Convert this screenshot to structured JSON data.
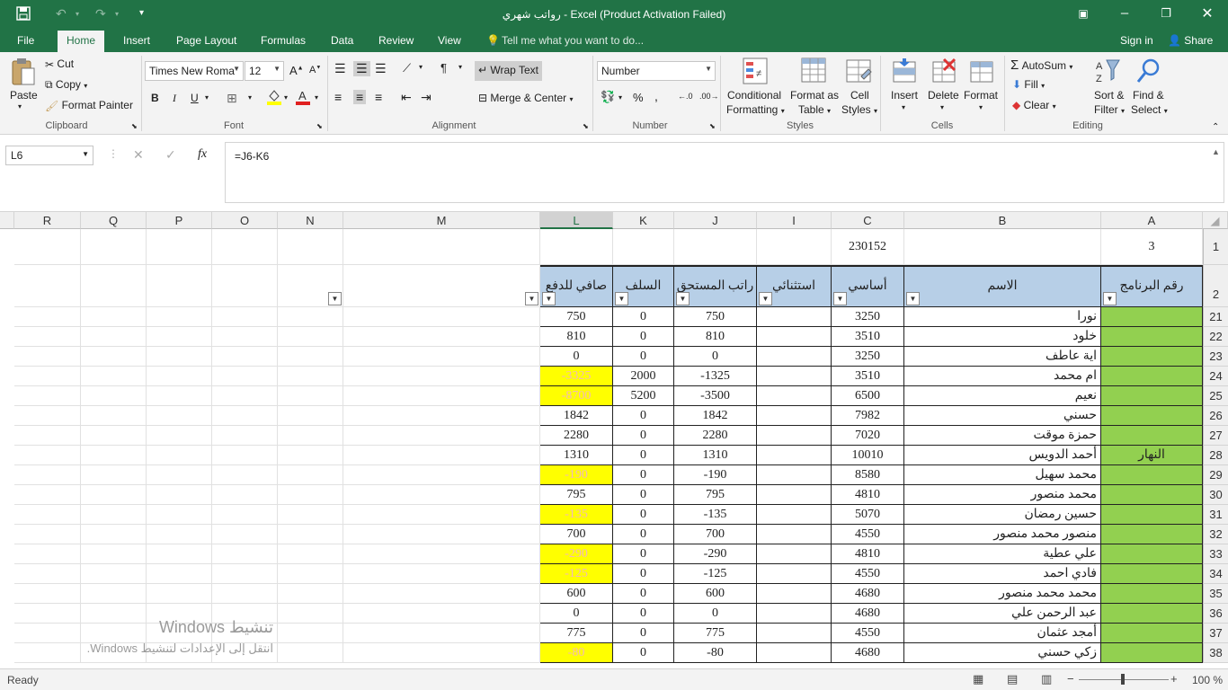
{
  "window": {
    "title": "رواتب شهري - Excel (Product Activation Failed)",
    "accent": "#217346"
  },
  "tabs": [
    "File",
    "Home",
    "Insert",
    "Page Layout",
    "Formulas",
    "Data",
    "Review",
    "View"
  ],
  "tell_me": "Tell me what you want to do...",
  "signin": "Sign in",
  "share": "Share",
  "ribbon": {
    "clipboard": {
      "paste": "Paste",
      "cut": "Cut",
      "copy": "Copy",
      "format_painter": "Format Painter",
      "label": "Clipboard"
    },
    "font": {
      "name": "Times New Roma",
      "size": "12",
      "label": "Font",
      "bold": "B",
      "italic": "I",
      "underline": "U"
    },
    "alignment": {
      "wrap": "Wrap Text",
      "merge": "Merge & Center",
      "label": "Alignment"
    },
    "number": {
      "format": "Number",
      "label": "Number"
    },
    "styles": {
      "conditional": "Conditional",
      "conditional2": "Formatting",
      "format_table": "Format as",
      "format_table2": "Table",
      "cell_styles": "Cell",
      "cell_styles2": "Styles",
      "label": "Styles"
    },
    "cells": {
      "insert": "Insert",
      "delete": "Delete",
      "format": "Format",
      "label": "Cells"
    },
    "editing": {
      "autosum": "AutoSum",
      "fill": "Fill",
      "clear": "Clear",
      "sort": "Sort &",
      "sort2": "Filter",
      "find": "Find &",
      "find2": "Select",
      "label": "Editing"
    }
  },
  "formula_bar": {
    "name_box": "L6",
    "formula": "=J6-K6"
  },
  "columns": [
    "R",
    "Q",
    "P",
    "O",
    "N",
    "M",
    "L",
    "K",
    "J",
    "I",
    "C",
    "B",
    "A"
  ],
  "selected_column": "L",
  "row1": {
    "row": "1",
    "C": "230152",
    "A": "3"
  },
  "headers": {
    "row": "2",
    "L": "صافي للدفع",
    "K": "السلف",
    "J": "راتب المستحق",
    "I": "استثنائي",
    "C": "أساسي",
    "B": "الاسم",
    "A": "رقم البرنامج"
  },
  "rows": [
    {
      "row": "21",
      "B": "نورا",
      "C": "3250",
      "I": "",
      "J": "750",
      "K": "0",
      "L": "750",
      "A": "",
      "yellow": false
    },
    {
      "row": "22",
      "B": "خلود",
      "C": "3510",
      "I": "",
      "J": "810",
      "K": "0",
      "L": "810",
      "A": "",
      "yellow": false
    },
    {
      "row": "23",
      "B": "اية عاطف",
      "C": "3250",
      "I": "",
      "J": "0",
      "K": "0",
      "L": "0",
      "A": "",
      "yellow": false
    },
    {
      "row": "24",
      "B": "ام محمد",
      "C": "3510",
      "I": "",
      "J": "-1325",
      "K": "2000",
      "L": "-3325",
      "A": "",
      "yellow": true
    },
    {
      "row": "25",
      "B": "نعيم",
      "C": "6500",
      "I": "",
      "J": "-3500",
      "K": "5200",
      "L": "-8700",
      "A": "",
      "yellow": true
    },
    {
      "row": "26",
      "B": "حسني",
      "C": "7982",
      "I": "",
      "J": "1842",
      "K": "0",
      "L": "1842",
      "A": "",
      "yellow": false
    },
    {
      "row": "27",
      "B": "حمزة موقت",
      "C": "7020",
      "I": "",
      "J": "2280",
      "K": "0",
      "L": "2280",
      "A": "",
      "yellow": false
    },
    {
      "row": "28",
      "B": "أحمد الدويس",
      "C": "10010",
      "I": "",
      "J": "1310",
      "K": "0",
      "L": "1310",
      "A": "النهار",
      "yellow": false
    },
    {
      "row": "29",
      "B": "محمد سهيل",
      "C": "8580",
      "I": "",
      "J": "-190",
      "K": "0",
      "L": "-190",
      "A": "",
      "yellow": true
    },
    {
      "row": "30",
      "B": "محمد منصور",
      "C": "4810",
      "I": "",
      "J": "795",
      "K": "0",
      "L": "795",
      "A": "",
      "yellow": false
    },
    {
      "row": "31",
      "B": "حسين رمضان",
      "C": "5070",
      "I": "",
      "J": "-135",
      "K": "0",
      "L": "-135",
      "A": "",
      "yellow": true
    },
    {
      "row": "32",
      "B": "منصور محمد منصور",
      "C": "4550",
      "I": "",
      "J": "700",
      "K": "0",
      "L": "700",
      "A": "",
      "yellow": false
    },
    {
      "row": "33",
      "B": "علي عطية",
      "C": "4810",
      "I": "",
      "J": "-290",
      "K": "0",
      "L": "-290",
      "A": "",
      "yellow": true
    },
    {
      "row": "34",
      "B": "فادي احمد",
      "C": "4550",
      "I": "",
      "J": "-125",
      "K": "0",
      "L": "-125",
      "A": "",
      "yellow": true
    },
    {
      "row": "35",
      "B": "محمد محمد منصور",
      "C": "4680",
      "I": "",
      "J": "600",
      "K": "0",
      "L": "600",
      "A": "",
      "yellow": false
    },
    {
      "row": "36",
      "B": "عبد الرحمن علي",
      "C": "4680",
      "I": "",
      "J": "0",
      "K": "0",
      "L": "0",
      "A": "",
      "yellow": false
    },
    {
      "row": "37",
      "B": "أمجد عثمان",
      "C": "4550",
      "I": "",
      "J": "775",
      "K": "0",
      "L": "775",
      "A": "",
      "yellow": false
    },
    {
      "row": "38",
      "B": "زكي حسني",
      "C": "4680",
      "I": "",
      "J": "-80",
      "K": "0",
      "L": "-80",
      "A": "",
      "yellow": true
    }
  ],
  "watermark": {
    "line1": "تنشيط Windows",
    "line2": "انتقل إلى الإعدادات لتنشيط Windows."
  },
  "status": {
    "ready": "Ready",
    "zoom": "100 %"
  },
  "colors": {
    "header_fill": "#b7cfe7",
    "green_fill": "#92d050",
    "yellow_fill": "#ffff00"
  }
}
